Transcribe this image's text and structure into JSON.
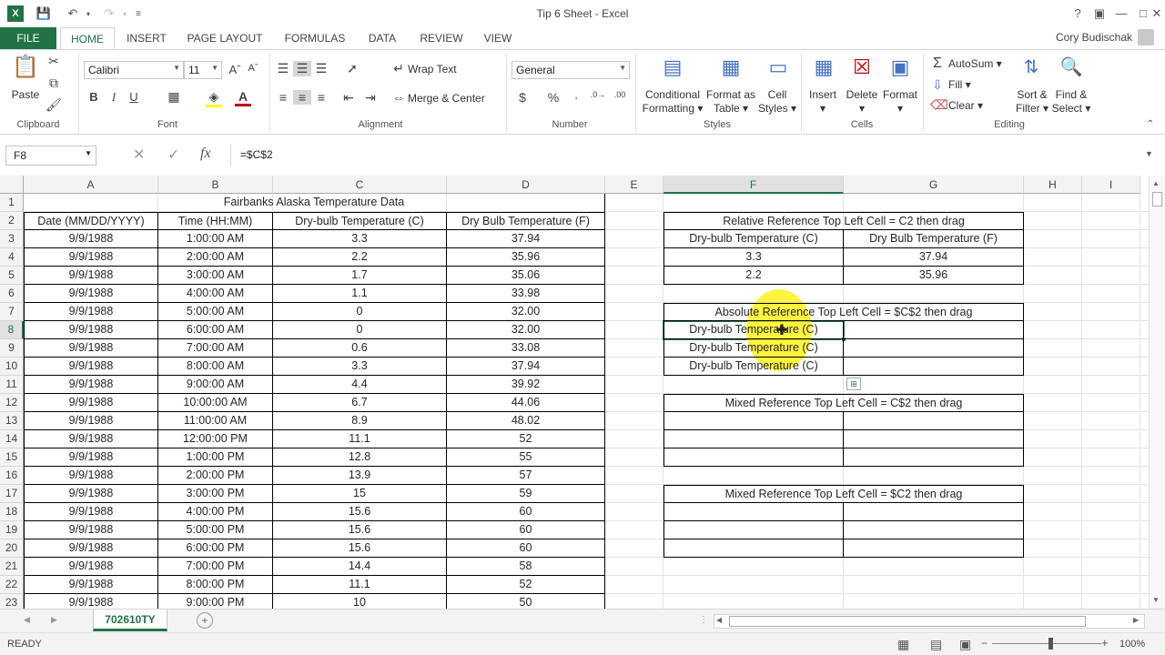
{
  "window": {
    "title": "Tip 6 Sheet - Excel",
    "user": "Cory Budischak"
  },
  "tabs": [
    "FILE",
    "HOME",
    "INSERT",
    "PAGE LAYOUT",
    "FORMULAS",
    "DATA",
    "REVIEW",
    "VIEW"
  ],
  "ribbon": {
    "clipboard": {
      "paste": "Paste",
      "label": "Clipboard"
    },
    "font": {
      "name": "Calibri",
      "size": "11",
      "label": "Font"
    },
    "alignment": {
      "wrap": "Wrap Text",
      "merge": "Merge & Center",
      "label": "Alignment"
    },
    "number": {
      "format": "General",
      "label": "Number"
    },
    "styles": {
      "cond1": "Conditional",
      "cond2": "Formatting",
      "fmt1": "Format as",
      "fmt2": "Table",
      "cell1": "Cell",
      "cell2": "Styles",
      "label": "Styles"
    },
    "cells": {
      "insert": "Insert",
      "delete": "Delete",
      "format": "Format",
      "label": "Cells"
    },
    "editing": {
      "autosum": "AutoSum",
      "fill": "Fill",
      "clear": "Clear",
      "sort1": "Sort &",
      "sort2": "Filter",
      "find1": "Find &",
      "find2": "Select",
      "label": "Editing"
    }
  },
  "formula_bar": {
    "name_box": "F8",
    "formula": "=$C$2"
  },
  "columns": [
    "A",
    "B",
    "C",
    "D",
    "E",
    "F",
    "G",
    "H",
    "I"
  ],
  "rows": [
    "1",
    "2",
    "3",
    "4",
    "5",
    "6",
    "7",
    "8",
    "9",
    "10",
    "11",
    "12",
    "13",
    "14",
    "15",
    "16",
    "17",
    "18",
    "19",
    "20",
    "21",
    "22",
    "23"
  ],
  "table": {
    "title": "Fairbanks Alaska Temperature Data",
    "headers": [
      "Date (MM/DD/YYYY)",
      "Time (HH:MM)",
      "Dry-bulb Temperature (C)",
      "Dry Bulb Temperature (F)"
    ],
    "rows": [
      [
        "9/9/1988",
        "1:00:00 AM",
        "3.3",
        "37.94"
      ],
      [
        "9/9/1988",
        "2:00:00 AM",
        "2.2",
        "35.96"
      ],
      [
        "9/9/1988",
        "3:00:00 AM",
        "1.7",
        "35.06"
      ],
      [
        "9/9/1988",
        "4:00:00 AM",
        "1.1",
        "33.98"
      ],
      [
        "9/9/1988",
        "5:00:00 AM",
        "0",
        "32.00"
      ],
      [
        "9/9/1988",
        "6:00:00 AM",
        "0",
        "32.00"
      ],
      [
        "9/9/1988",
        "7:00:00 AM",
        "0.6",
        "33.08"
      ],
      [
        "9/9/1988",
        "8:00:00 AM",
        "3.3",
        "37.94"
      ],
      [
        "9/9/1988",
        "9:00:00 AM",
        "4.4",
        "39.92"
      ],
      [
        "9/9/1988",
        "10:00:00 AM",
        "6.7",
        "44.06"
      ],
      [
        "9/9/1988",
        "11:00:00 AM",
        "8.9",
        "48.02"
      ],
      [
        "9/9/1988",
        "12:00:00 PM",
        "11.1",
        "52"
      ],
      [
        "9/9/1988",
        "1:00:00 PM",
        "12.8",
        "55"
      ],
      [
        "9/9/1988",
        "2:00:00 PM",
        "13.9",
        "57"
      ],
      [
        "9/9/1988",
        "3:00:00 PM",
        "15",
        "59"
      ],
      [
        "9/9/1988",
        "4:00:00 PM",
        "15.6",
        "60"
      ],
      [
        "9/9/1988",
        "5:00:00 PM",
        "15.6",
        "60"
      ],
      [
        "9/9/1988",
        "6:00:00 PM",
        "15.6",
        "60"
      ],
      [
        "9/9/1988",
        "7:00:00 PM",
        "14.4",
        "58"
      ],
      [
        "9/9/1988",
        "8:00:00 PM",
        "11.1",
        "52"
      ],
      [
        "9/9/1988",
        "9:00:00 PM",
        "10",
        "50"
      ]
    ]
  },
  "side": {
    "rel_title": "Relative Reference Top Left Cell = C2 then drag",
    "rel_h1": "Dry-bulb Temperature (C)",
    "rel_h2": "Dry Bulb Temperature (F)",
    "rel_r1": [
      "3.3",
      "37.94"
    ],
    "rel_r2": [
      "2.2",
      "35.96"
    ],
    "abs_title": "Absolute Reference Top Left Cell = $C$2 then drag",
    "abs_vals": [
      "Dry-bulb Temperature (C)",
      "Dry-bulb Temperature (C)",
      "Dry-bulb Temperature (C)"
    ],
    "mix1_title": "Mixed Reference Top Left Cell = C$2 then drag",
    "mix2_title": "Mixed Reference Top Left Cell = $C2 then drag"
  },
  "sheet_tab": "702610TY",
  "status": {
    "text": "READY",
    "zoom": "100%"
  }
}
